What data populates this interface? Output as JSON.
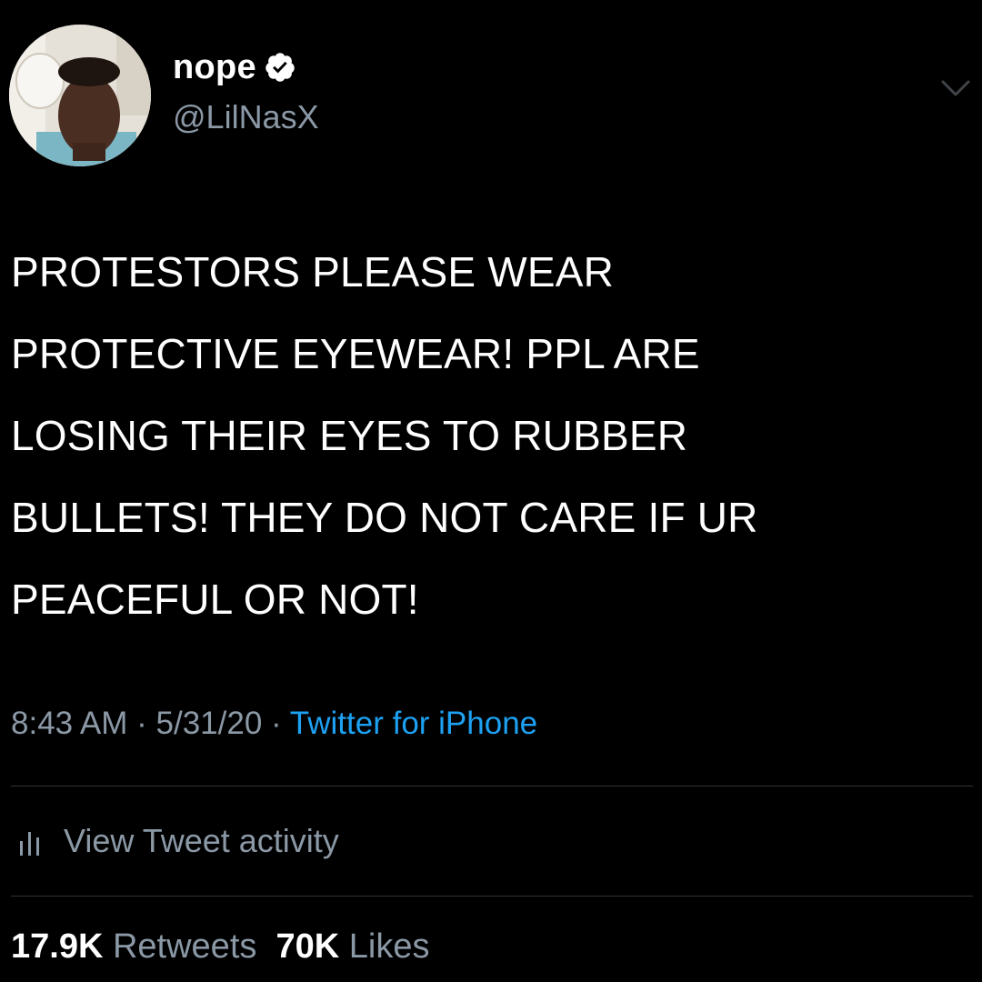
{
  "author": {
    "display_name": "nope",
    "handle": "@LilNasX",
    "verified": true,
    "avatar_icon": "profile-photo"
  },
  "tweet": {
    "text": "PROTESTORS PLEASE WEAR\nPROTECTIVE EYEWEAR! PPL ARE\nLOSING THEIR EYES TO RUBBER\nBULLETS! THEY DO NOT CARE IF UR\nPEACEFUL OR NOT!"
  },
  "meta": {
    "time": "8:43 AM",
    "separator": " · ",
    "date": "5/31/20",
    "source": "Twitter for iPhone"
  },
  "activity": {
    "label": "View Tweet activity",
    "icon": "bar-chart-icon"
  },
  "stats": {
    "retweets_count": "17.9K",
    "retweets_label": "Retweets",
    "likes_count": "70K",
    "likes_label": "Likes"
  },
  "colors": {
    "background": "#000000",
    "text_primary": "#ffffff",
    "text_secondary": "#8b98a5",
    "accent": "#1da1f2",
    "divider": "#2f3336"
  }
}
